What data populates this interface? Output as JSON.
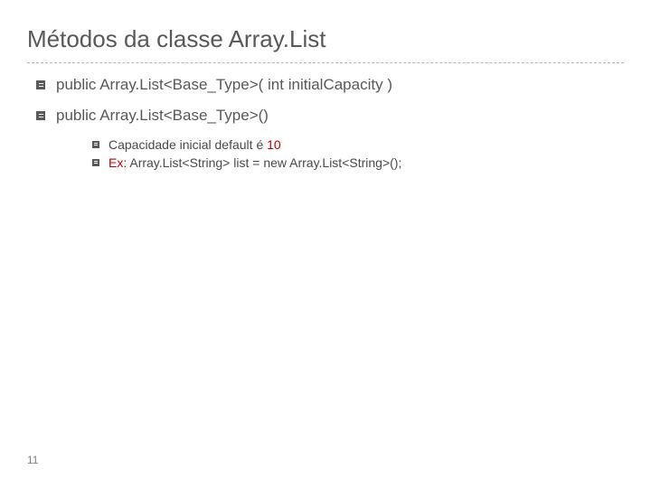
{
  "title": "Métodos da classe Array.List",
  "items": [
    {
      "text": "public Array.List<Base_Type>( int  initialCapacity )"
    },
    {
      "text": "public Array.List<Base_Type>()",
      "sub": [
        {
          "pre": "Capacidade inicial default é ",
          "red": "10",
          "post": ""
        },
        {
          "pre": "",
          "red": "Ex:",
          "post": "  Array.List<String>  list = new Array.List<String>();"
        }
      ]
    }
  ],
  "page_number": "11"
}
